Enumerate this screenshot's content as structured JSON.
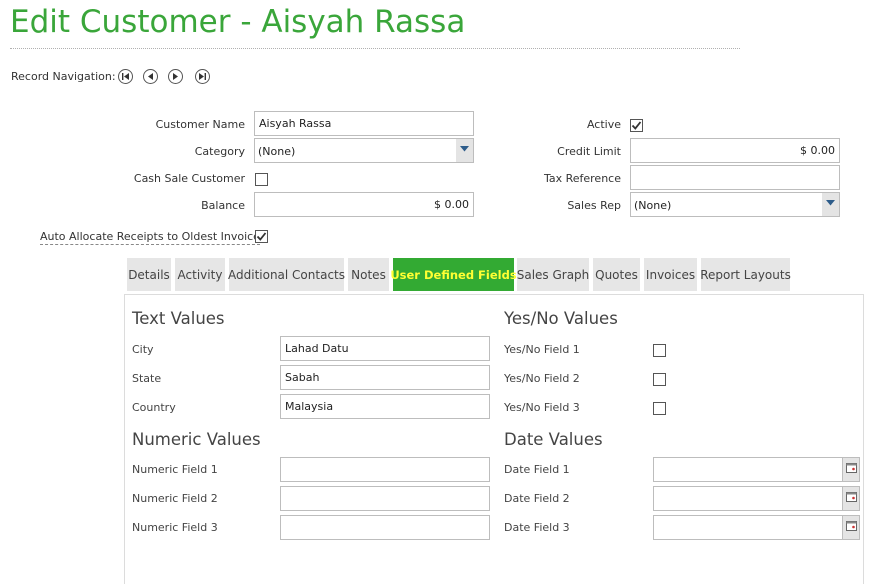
{
  "page": {
    "title": "Edit Customer - Aisyah Rassa",
    "record_nav_label": "Record Navigation:"
  },
  "form": {
    "customer_name_label": "Customer Name",
    "customer_name_value": "Aisyah Rassa",
    "category_label": "Category",
    "category_value": "(None)",
    "cash_sale_label": "Cash Sale Customer",
    "cash_sale_checked": false,
    "balance_label": "Balance",
    "balance_value": "$ 0.00",
    "active_label": "Active",
    "active_checked": true,
    "credit_limit_label": "Credit Limit",
    "credit_limit_value": "$ 0.00",
    "tax_reference_label": "Tax Reference",
    "tax_reference_value": "",
    "sales_rep_label": "Sales Rep",
    "sales_rep_value": "(None)",
    "auto_allocate_label": "Auto Allocate Receipts to Oldest Invoice",
    "auto_allocate_checked": true
  },
  "tabs": [
    {
      "label": "Details",
      "active": false
    },
    {
      "label": "Activity",
      "active": false
    },
    {
      "label": "Additional Contacts",
      "active": false
    },
    {
      "label": "Notes",
      "active": false
    },
    {
      "label": "User Defined Fields",
      "active": true
    },
    {
      "label": "Sales Graph",
      "active": false
    },
    {
      "label": "Quotes",
      "active": false
    },
    {
      "label": "Invoices",
      "active": false
    },
    {
      "label": "Report Layouts",
      "active": false
    }
  ],
  "udf": {
    "text_values": {
      "heading": "Text Values",
      "fields": [
        {
          "label": "City",
          "value": "Lahad Datu"
        },
        {
          "label": "State",
          "value": "Sabah"
        },
        {
          "label": "Country",
          "value": "Malaysia"
        }
      ]
    },
    "yes_no_values": {
      "heading": "Yes/No Values",
      "fields": [
        {
          "label": "Yes/No Field 1",
          "checked": false
        },
        {
          "label": "Yes/No Field 2",
          "checked": false
        },
        {
          "label": "Yes/No Field 3",
          "checked": false
        }
      ]
    },
    "numeric_values": {
      "heading": "Numeric Values",
      "fields": [
        {
          "label": "Numeric Field 1",
          "value": ""
        },
        {
          "label": "Numeric Field 2",
          "value": ""
        },
        {
          "label": "Numeric Field 3",
          "value": ""
        }
      ]
    },
    "date_values": {
      "heading": "Date Values",
      "fields": [
        {
          "label": "Date Field 1",
          "value": ""
        },
        {
          "label": "Date Field 2",
          "value": ""
        },
        {
          "label": "Date Field 3",
          "value": ""
        }
      ]
    }
  },
  "colors": {
    "title": "#3aa63a",
    "active_tab_bg": "#33aa33",
    "active_tab_text": "#ffff33"
  },
  "icons": {
    "nav": [
      "first-record-icon",
      "previous-record-icon",
      "next-record-icon",
      "last-record-icon"
    ],
    "checkmark": "check-icon",
    "dropdown": "chevron-down-icon",
    "calendar": "calendar-icon"
  }
}
